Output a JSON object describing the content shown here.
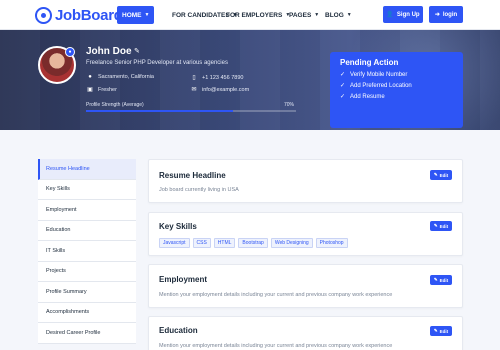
{
  "brand": {
    "name": "JobBoard"
  },
  "nav": {
    "items": [
      {
        "label": "HOME"
      },
      {
        "label": "FOR CANDIDATES"
      },
      {
        "label": "FOR EMPLOYERS"
      },
      {
        "label": "PAGES"
      },
      {
        "label": "BLOG"
      }
    ],
    "signup_label": "Sign Up",
    "login_label": "login"
  },
  "profile": {
    "name": "John Doe",
    "tagline": "Freelance Senior PHP Developer at various agencies",
    "location": "Sacramento, California",
    "phone": "+1 123 456 7890",
    "experience": "Fresher",
    "email": "info@example.com",
    "strength_label": "Profile Strength (Average)",
    "strength_text": "70%",
    "strength_value": 70
  },
  "pending": {
    "title": "Pending Action",
    "items": [
      "Verify Mobile Number",
      "Add Preferred Location",
      "Add Resume"
    ]
  },
  "sidebar": {
    "items": [
      "Resume Headline",
      "Key Skills",
      "Employment",
      "Education",
      "IT Skills",
      "Projects",
      "Profile Summary",
      "Accomplishments",
      "Desired Career Profile"
    ]
  },
  "cards": {
    "headline": {
      "title": "Resume Headline",
      "text": "Job board currently living in USA",
      "edit": "Edit"
    },
    "skills": {
      "title": "Key Skills",
      "edit": "Edit",
      "tags": [
        "Javascript",
        "CSS",
        "HTML",
        "Bootstrap",
        "Web Designing",
        "Photoshop"
      ]
    },
    "employment": {
      "title": "Employment",
      "text": "Mention your employment details including your current and previous company work experience",
      "edit": "Edit"
    },
    "education": {
      "title": "Education",
      "text": "Mention your employment details including your current and previous company work experience",
      "edit": "Edit"
    }
  },
  "colors": {
    "accent": "#2e55f5",
    "hero_dark": "#2c3556"
  },
  "icons": {
    "location": "map-pin-icon",
    "phone": "phone-icon",
    "experience": "briefcase-icon",
    "email": "mail-icon",
    "edit": "pencil-icon",
    "check": "check-icon"
  }
}
